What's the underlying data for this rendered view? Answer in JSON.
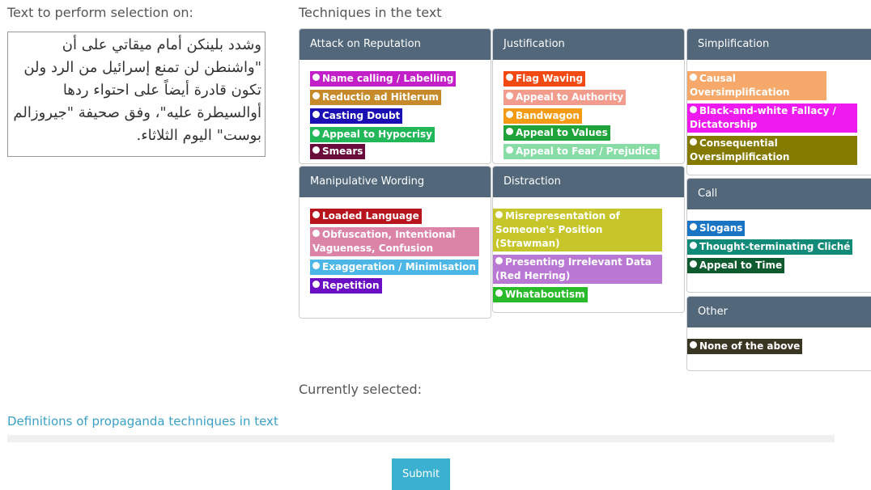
{
  "source": {
    "label": "Text to perform selection on:",
    "text": "وشدد بلينكن أمام ميقاتي على أن \"واشنطن لن تمنع إسرائيل من الرد ولن تكون قادرة أيضاً على احتواء ردها أوالسيطرة عليه\"، وفق صحيفة \"جيروزالم بوست\" اليوم الثلاثاء."
  },
  "techniques": {
    "label": "Techniques in the text",
    "panels": {
      "reputation": {
        "title": "Attack on Reputation",
        "items": [
          {
            "label": "Name calling / Labelling",
            "color": "#c21fc8"
          },
          {
            "label": "Reductio ad Hitlerum",
            "color": "#c68a2a"
          },
          {
            "label": "Casting Doubt",
            "color": "#1a0fb5"
          },
          {
            "label": "Appeal to Hypocrisy",
            "color": "#22b85a"
          },
          {
            "label": "Smears",
            "color": "#6b0b3c"
          }
        ]
      },
      "justification": {
        "title": "Justification",
        "items": [
          {
            "label": "Flag Waving",
            "color": "#f24a12"
          },
          {
            "label": "Appeal to Authority",
            "color": "#f29c8e"
          },
          {
            "label": "Bandwagon",
            "color": "#f49b13"
          },
          {
            "label": "Appeal to Values",
            "color": "#1ea33a"
          },
          {
            "label": "Appeal to Fear / Prejudice",
            "color": "#88dca6"
          }
        ]
      },
      "simplification": {
        "title": "Simplification",
        "items": [
          {
            "label": "Causal Oversimplification",
            "color": "#f6a96a"
          },
          {
            "label": "Black-and-white Fallacy / Dictatorship",
            "color": "#ee1af0"
          },
          {
            "label": "Consequential Oversimplification",
            "color": "#857a00"
          }
        ]
      },
      "wording": {
        "title": "Manipulative Wording",
        "items": [
          {
            "label": "Loaded Language",
            "color": "#b8141e"
          },
          {
            "label": "Obfuscation, Intentional Vagueness, Confusion",
            "color": "#dc84a8"
          },
          {
            "label": "Exaggeration / Minimisation",
            "color": "#4cb6e6"
          },
          {
            "label": "Repetition",
            "color": "#6a0fc4"
          }
        ]
      },
      "distraction": {
        "title": "Distraction",
        "items": [
          {
            "label": "Misrepresentation of Someone's Position (Strawman)",
            "color": "#c6c62a"
          },
          {
            "label": "Presenting Irrelevant Data (Red Herring)",
            "color": "#b878d4"
          },
          {
            "label": "Whataboutism",
            "color": "#28ba28"
          }
        ]
      },
      "call": {
        "title": "Call",
        "items": [
          {
            "label": "Slogans",
            "color": "#1a74c4"
          },
          {
            "label": "Thought-terminating Cliché",
            "color": "#128a78"
          },
          {
            "label": "Appeal to Time",
            "color": "#0f5a2e"
          }
        ]
      },
      "other": {
        "title": "Other",
        "items": [
          {
            "label": "None of the above",
            "color": "#3a3624"
          }
        ]
      }
    }
  },
  "selected": {
    "label": "Currently selected:"
  },
  "definitions": {
    "label": "Definitions of propaganda techniques in text"
  },
  "submit": {
    "label": "Submit"
  }
}
